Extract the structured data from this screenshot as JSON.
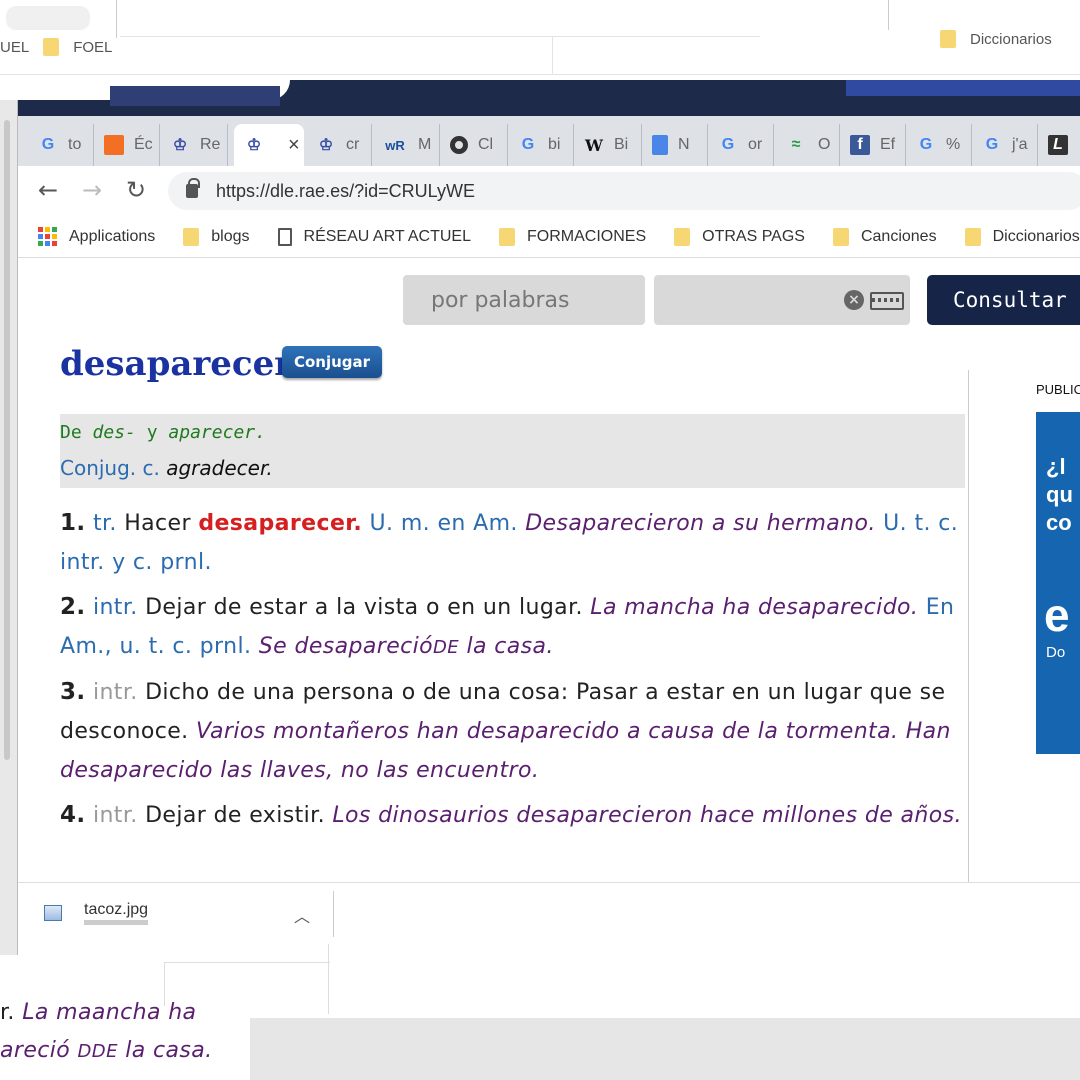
{
  "top_ghost": {
    "bookmarks_left": [
      "UEL",
      "FOEL"
    ],
    "bookmark_right": "Diccionarios"
  },
  "tabs": [
    {
      "label": "to",
      "icon": "google-icon"
    },
    {
      "label": "Éc",
      "icon": "soundcloud-icon"
    },
    {
      "label": "Re",
      "icon": "rae-crest-icon"
    },
    {
      "label": "",
      "icon": "rae-crest-icon",
      "active": true
    },
    {
      "label": "cr",
      "icon": "rae-crest-icon"
    },
    {
      "label": "M",
      "icon": "wordreference-icon"
    },
    {
      "label": "Cl",
      "icon": "circle-icon"
    },
    {
      "label": "bi",
      "icon": "google-icon"
    },
    {
      "label": "Bi",
      "icon": "wikipedia-icon"
    },
    {
      "label": "N",
      "icon": "docs-icon"
    },
    {
      "label": "or",
      "icon": "google-icon"
    },
    {
      "label": "O",
      "icon": "green-logo-icon"
    },
    {
      "label": "Ef",
      "icon": "facebook-icon"
    },
    {
      "label": "%",
      "icon": "google-icon"
    },
    {
      "label": "j'a",
      "icon": "google-icon"
    },
    {
      "label": "",
      "icon": "l-logo-icon"
    }
  ],
  "toolbar": {
    "url": "https://dle.rae.es/?id=CRULyWE"
  },
  "bookmarks": [
    {
      "label": "Applications",
      "icon": "apps-grid-icon"
    },
    {
      "label": "blogs",
      "icon": "folder-icon"
    },
    {
      "label": "RÉSEAU ART ACTUEL",
      "icon": "page-icon"
    },
    {
      "label": "FORMACIONES",
      "icon": "folder-icon"
    },
    {
      "label": "OTRAS PAGS",
      "icon": "folder-icon"
    },
    {
      "label": "Canciones",
      "icon": "folder-icon"
    },
    {
      "label": "Diccionarios",
      "icon": "folder-icon"
    }
  ],
  "search": {
    "mode": "por palabras",
    "query": "",
    "button": "Consultar"
  },
  "entry": {
    "headword": "desaparecer",
    "conjugate_button": "Conjugar",
    "etymology": {
      "de": "De",
      "part1": "des-",
      "y": "y",
      "part2": "aparecer.",
      "conj_label": "Conjug. c.",
      "conj_verb": "agradecer."
    },
    "definitions": [
      {
        "num": "1.",
        "abbr": "tr.",
        "text": "Hacer",
        "keyword": "desaparecer.",
        "note": "U. m. en Am.",
        "example": "Desaparecieron a su hermano.",
        "note2": "U. t. c. intr. y c. prnl."
      },
      {
        "num": "2.",
        "abbr": "intr.",
        "text": "Dejar de estar a la vista o en un lugar.",
        "example": "La mancha ha desaparecido.",
        "note": "En Am., u. t. c. prnl.",
        "example2a": "Se desapareció",
        "example2b": "DE",
        "example2c": "la casa."
      },
      {
        "num": "3.",
        "abbr": "intr.",
        "text": "Dicho de una persona o de una cosa: Pasar a estar en un lugar que se desconoce.",
        "example": "Varios montañeros han desaparecido a causa de la tormenta. Han desaparecido las llaves, no las encuentro."
      },
      {
        "num": "4.",
        "abbr": "intr.",
        "text": "Dejar de existir.",
        "example": "Los dinosaurios desaparecieron hace millones de años."
      }
    ]
  },
  "ad": {
    "label": "PUBLIC",
    "line1": "¿l",
    "line2": "qu",
    "line3": "co",
    "big": "e",
    "small": "Do"
  },
  "download": {
    "filename": "tacoz.jpg"
  },
  "fragment": {
    "line1_prefix": "r.",
    "line1_example": "La maancha ha",
    "line2_a": "areció",
    "line2_b": "DDE",
    "line2_c": "la casa."
  },
  "colors": {
    "headword": "#1a33a0",
    "keyword_red": "#d42020",
    "abbr_blue": "#2b6cb0",
    "example_purple": "#5a1f6e",
    "etym_green": "#1f7a1f",
    "consult_navy": "#152447",
    "ad_blue": "#1565b0"
  }
}
